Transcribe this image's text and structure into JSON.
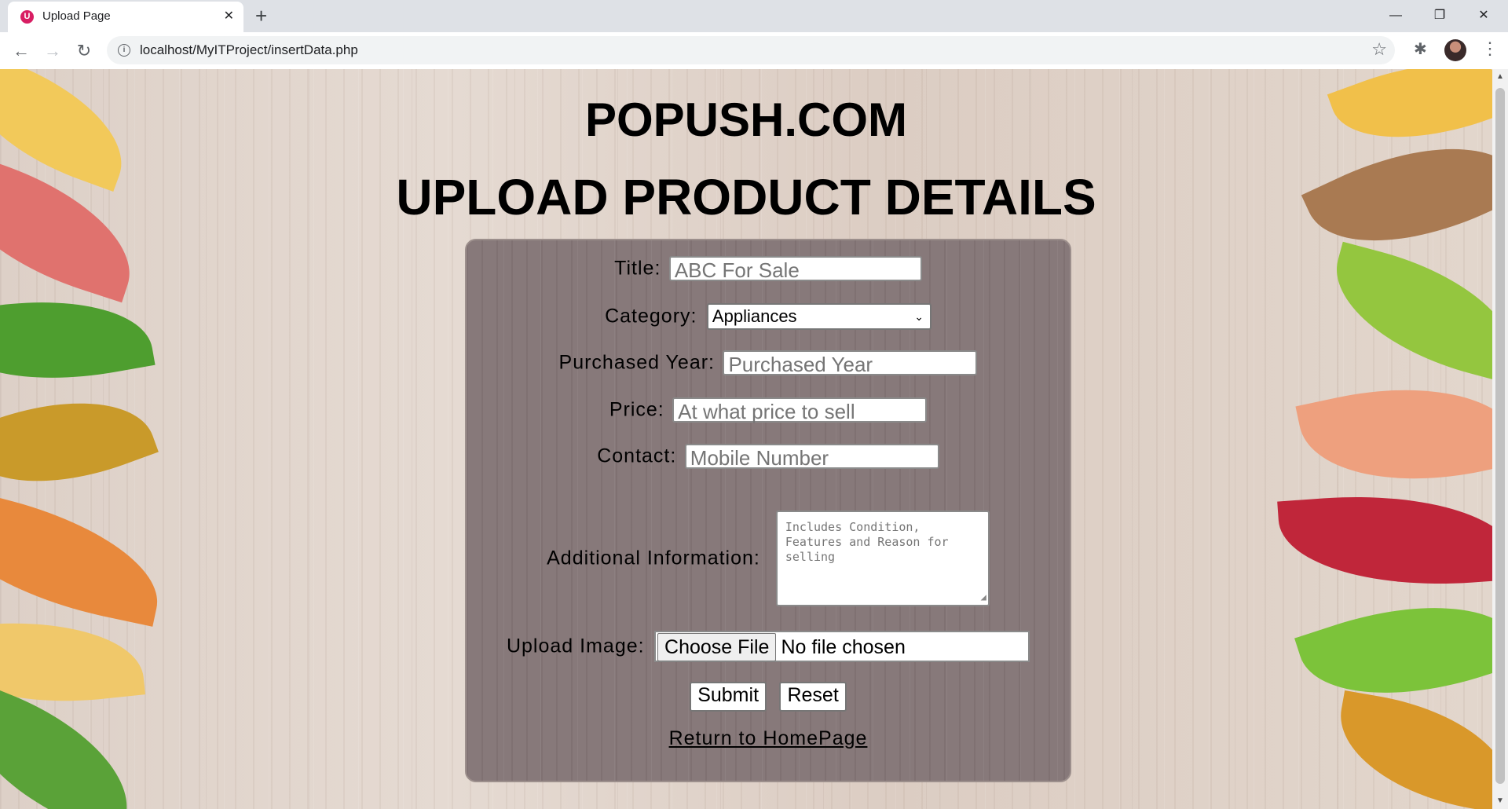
{
  "browser": {
    "tab_title": "Upload Page",
    "favicon_letter": "U",
    "tab_close": "✕",
    "new_tab": "+",
    "url": "localhost/MyITProject/insertData.php",
    "controls": {
      "back": "←",
      "forward": "→",
      "reload": "↻",
      "info": "i",
      "star": "☆",
      "extensions": "✱",
      "menu": "⋮"
    },
    "window": {
      "minimize": "—",
      "restore": "❐",
      "close": "✕"
    }
  },
  "page": {
    "site_title": "POPUSH.COM",
    "heading": "UPLOAD PRODUCT DETAILS"
  },
  "form": {
    "title_label": "Title:",
    "title_placeholder": "ABC For Sale",
    "category_label": "Category:",
    "category_value": "Appliances",
    "category_chevron": "⌄",
    "year_label": "Purchased Year:",
    "year_placeholder": "Purchased Year",
    "price_label": "Price:",
    "price_placeholder": "At what price to sell",
    "contact_label": "Contact:",
    "contact_placeholder": "Mobile Number",
    "info_label": "Additional Information:",
    "info_placeholder": "Includes Condition, Features and Reason for selling",
    "image_label": "Upload Image:",
    "file_button": "Choose File",
    "file_status": "No file chosen",
    "submit": "Submit",
    "reset": "Reset",
    "home_link": "Return to HomePage"
  }
}
